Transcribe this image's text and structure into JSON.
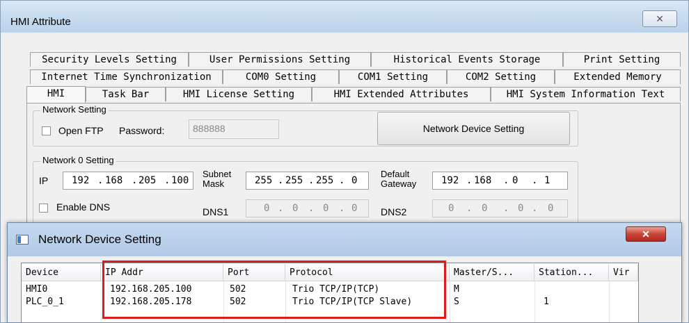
{
  "hmi_window": {
    "title": "HMI Attribute",
    "close_icon": "close-x-icon",
    "tabs_row1": [
      "Security Levels Setting",
      "User Permissions Setting",
      "Historical Events Storage",
      "Print Setting"
    ],
    "tabs_row2": [
      "Internet Time Synchronization",
      "COM0 Setting",
      "COM1 Setting",
      "COM2 Setting",
      "Extended Memory"
    ],
    "tabs_row3": [
      "HMI",
      "Task Bar",
      "HMI License Setting",
      "HMI Extended Attributes",
      "HMI System Information Text"
    ],
    "active_tab": "HMI"
  },
  "network_setting": {
    "legend": "Network Setting",
    "open_ftp_label": "Open FTP",
    "open_ftp_checked": false,
    "password_label": "Password:",
    "password_value": "888888",
    "network_device_button": "Network Device Setting"
  },
  "network0": {
    "legend": "Network 0 Setting",
    "ip_label": "IP",
    "ip": [
      "192",
      "168",
      "205",
      "100"
    ],
    "subnet_label_1": "Subnet",
    "subnet_label_2": "Mask",
    "subnet": [
      "255",
      "255",
      "255",
      "0"
    ],
    "gateway_label_1": "Default",
    "gateway_label_2": "Gateway",
    "gateway": [
      "192",
      "168",
      "0",
      "1"
    ],
    "enable_dns_label": "Enable DNS",
    "dns1_label": "DNS1",
    "dns1": [
      "0",
      "0",
      "0",
      "0"
    ],
    "dns2_label": "DNS2",
    "dns2": [
      "0",
      "0",
      "0",
      "0"
    ]
  },
  "device_dialog": {
    "title": "Network Device Setting",
    "close_icon": "close-x-icon",
    "columns": [
      "Device",
      "IP Addr",
      "Port",
      "Protocol",
      "Master/S...",
      "Station...",
      "Vir"
    ],
    "rows": [
      [
        "HMI0",
        "192.168.205.100",
        "502",
        "Trio TCP/IP(TCP)",
        "M",
        "",
        ""
      ],
      [
        "PLC_0_1",
        "192.168.205.178",
        "502",
        "Trio TCP/IP(TCP Slave)",
        "S",
        "1",
        ""
      ]
    ],
    "highlight_color": "#e01b1b"
  }
}
